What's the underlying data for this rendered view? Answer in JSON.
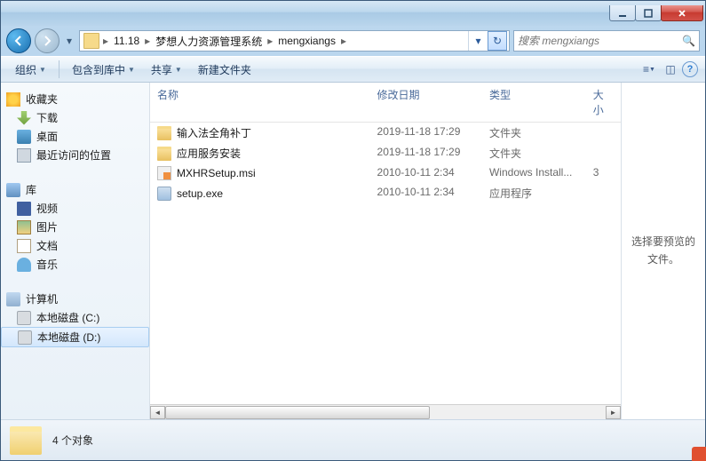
{
  "breadcrumbs": [
    "11.18",
    "梦想人力资源管理系统",
    "mengxiangs"
  ],
  "search": {
    "placeholder": "搜索 mengxiangs"
  },
  "toolbar": {
    "organize": "组织",
    "include": "包含到库中",
    "share": "共享",
    "newfolder": "新建文件夹"
  },
  "columns": {
    "name": "名称",
    "date": "修改日期",
    "type": "类型",
    "size": "大小"
  },
  "sidebar": {
    "favorites": {
      "label": "收藏夹",
      "items": [
        {
          "label": "下载",
          "icon": "dl"
        },
        {
          "label": "桌面",
          "icon": "desk"
        },
        {
          "label": "最近访问的位置",
          "icon": "rec"
        }
      ]
    },
    "libraries": {
      "label": "库",
      "items": [
        {
          "label": "视频",
          "icon": "vid"
        },
        {
          "label": "图片",
          "icon": "pic"
        },
        {
          "label": "文档",
          "icon": "doc"
        },
        {
          "label": "音乐",
          "icon": "mus"
        }
      ]
    },
    "computer": {
      "label": "计算机",
      "items": [
        {
          "label": "本地磁盘 (C:)",
          "icon": "disk"
        },
        {
          "label": "本地磁盘 (D:)",
          "icon": "disk",
          "selected": true
        }
      ]
    }
  },
  "files": [
    {
      "name": "输入法全角补丁",
      "date": "2019-11-18 17:29",
      "type": "文件夹",
      "size": "",
      "icon": "folder"
    },
    {
      "name": "应用服务安装",
      "date": "2019-11-18 17:29",
      "type": "文件夹",
      "size": "",
      "icon": "folder"
    },
    {
      "name": "MXHRSetup.msi",
      "date": "2010-10-11 2:34",
      "type": "Windows Install...",
      "size": "3",
      "icon": "msi"
    },
    {
      "name": "setup.exe",
      "date": "2010-10-11 2:34",
      "type": "应用程序",
      "size": "",
      "icon": "exe"
    }
  ],
  "preview": {
    "text": "选择要预览的文件。"
  },
  "status": {
    "text": "4 个对象"
  }
}
